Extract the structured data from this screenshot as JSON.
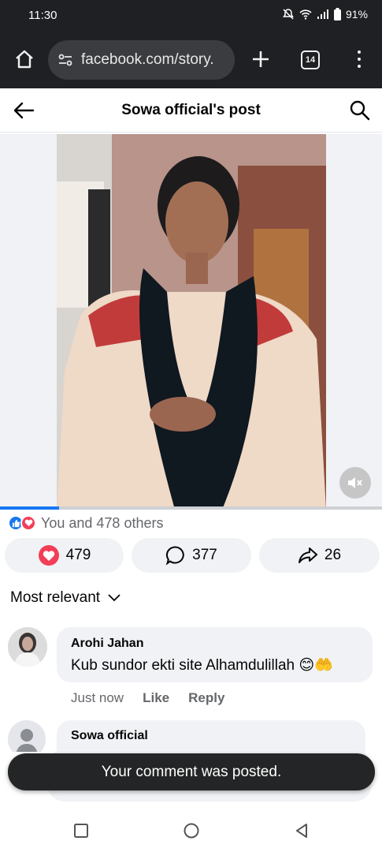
{
  "status_bar": {
    "time": "11:30",
    "battery": "91%"
  },
  "browser": {
    "url": "facebook.com/story.",
    "tab_count": "14"
  },
  "header": {
    "title": "Sowa official's post"
  },
  "video": {
    "progress": 0.155
  },
  "reactions": {
    "summary": "You and 478 others"
  },
  "actions": {
    "like_count": "479",
    "comment_count": "377",
    "share_count": "26"
  },
  "sort": {
    "label": "Most relevant"
  },
  "comments": [
    {
      "author": "Arohi Jahan",
      "text": "Kub sundor ekti site Alhamdulillah 😊🤲",
      "time": "Just now",
      "like_label": "Like",
      "reply_label": "Reply"
    },
    {
      "author": "Sowa official"
    }
  ],
  "toast": {
    "message": "Your comment was posted."
  },
  "colors": {
    "accent": "#1877f2",
    "love": "#f33e58",
    "toolbar": "#1f2023"
  }
}
